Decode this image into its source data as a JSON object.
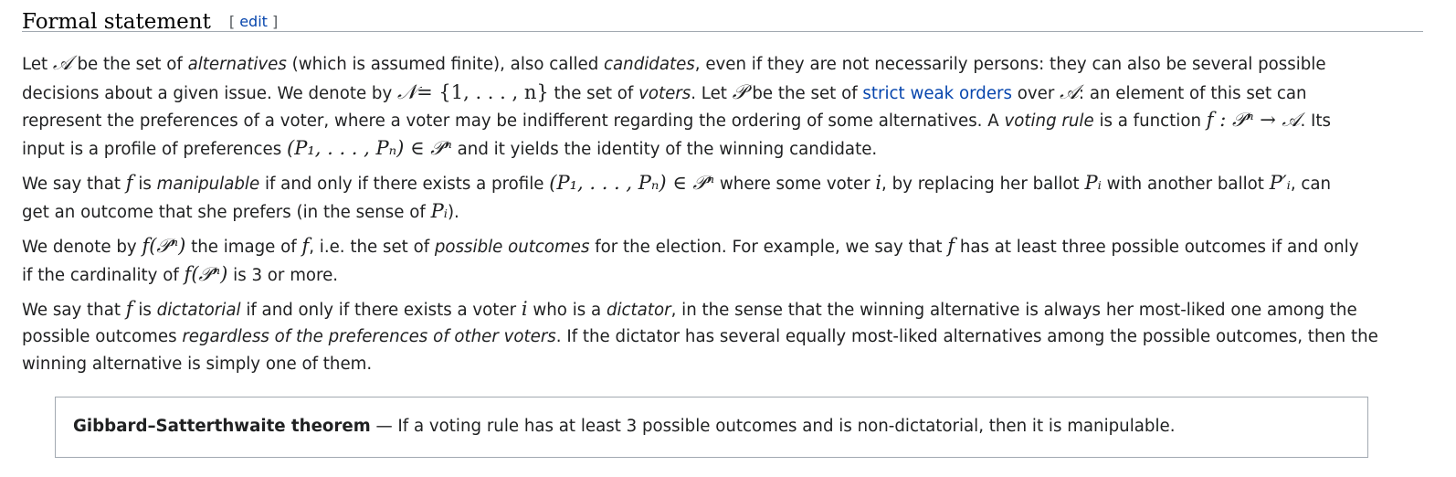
{
  "section": {
    "title": "Formal statement",
    "edit_open": "[ ",
    "edit_label": "edit",
    "edit_close": " ]"
  },
  "math": {
    "A": "𝒜",
    "N": "𝒩",
    "P": "𝒫",
    "N_set": "= {1, . . . , n}",
    "f": "f",
    "i": "i",
    "arrow_sig": "f : 𝒫ⁿ → 𝒜",
    "profile": "(P₁, . . . , Pₙ) ∈ 𝒫ⁿ",
    "Pi": "Pᵢ",
    "Pi_prime": "P′ᵢ",
    "image": "f(𝒫ⁿ)"
  },
  "para1": {
    "l1_a": "Let ",
    "l1_b": " be the set of ",
    "l1_c": "alternatives",
    "l1_d": " (which is assumed finite), also called ",
    "l1_e": "candidates",
    "l1_f": ", even if they are not necessarily persons: they can also be several possible",
    "l2_a": "decisions about a given issue. We denote by ",
    "l2_b": " the set of ",
    "l2_c": "voters",
    "l2_d": ". Let ",
    "l2_e": " be the set of ",
    "l2_link": "strict weak orders",
    "l2_f": " over ",
    "l2_g": ": an element of this set can",
    "l3_a": "represent the preferences of a voter, where a voter may be indifferent regarding the ordering of some alternatives. A ",
    "l3_b": "voting rule",
    "l3_c": " is a function ",
    "l3_d": ". Its",
    "l4_a": "input is a profile of preferences ",
    "l4_b": " and it yields the identity of the winning candidate."
  },
  "para2": {
    "l1_a": "We say that ",
    "l1_b": " is ",
    "l1_c": "manipulable",
    "l1_d": " if and only if there exists a profile ",
    "l1_e": " where some voter ",
    "l1_f": ", by replacing her ballot ",
    "l1_g": " with another ballot ",
    "l1_h": ", can",
    "l2_a": "get an outcome that she prefers (in the sense of ",
    "l2_b": ")."
  },
  "para3": {
    "l1_a": "We denote by ",
    "l1_b": " the image of ",
    "l1_c": ", i.e. the set of ",
    "l1_d": "possible outcomes",
    "l1_e": " for the election. For example, we say that ",
    "l1_f": " has at least three possible outcomes if and only",
    "l2_a": "if the cardinality of ",
    "l2_b": " is 3 or more."
  },
  "para4": {
    "l1_a": "We say that ",
    "l1_b": " is ",
    "l1_c": "dictatorial",
    "l1_d": " if and only if there exists a voter ",
    "l1_e": " who is a ",
    "l1_f": "dictator",
    "l1_g": ", in the sense that the winning alternative is always her most-liked one among the",
    "l2_a": "possible outcomes ",
    "l2_b": "regardless of the preferences of other voters",
    "l2_c": ". If the dictator has several equally most-liked alternatives among the possible outcomes, then the",
    "l3_a": "winning alternative is simply one of them."
  },
  "theorem": {
    "name": "Gibbard–Satterthwaite theorem",
    "text": " — If a voting rule has at least 3 possible outcomes and is non-dictatorial, then it is manipulable."
  }
}
